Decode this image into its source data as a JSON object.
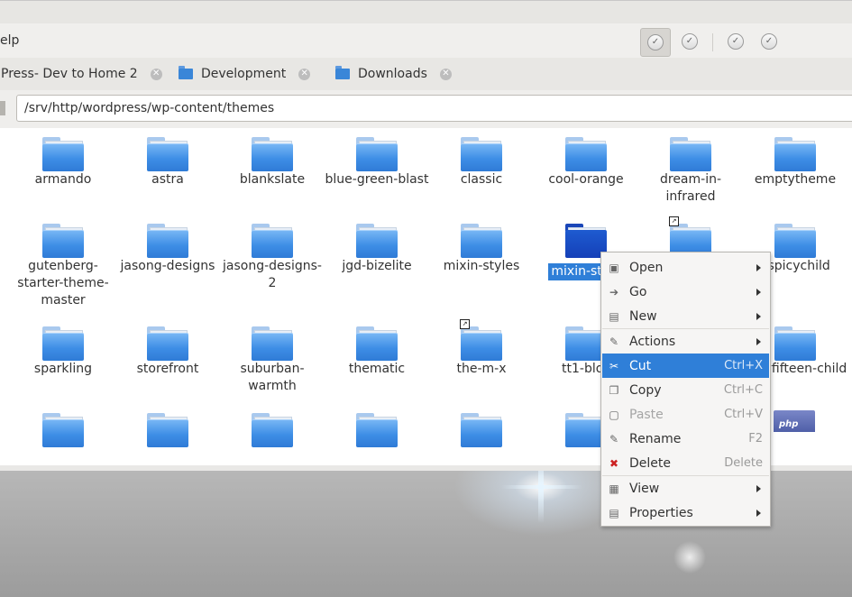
{
  "menu": {
    "help_label": "elp"
  },
  "toolbar": {
    "buttons": [
      {
        "name": "toolbar-check-1",
        "icon": "check-circle-icon",
        "active": true
      },
      {
        "name": "toolbar-check-2",
        "icon": "check-circle-icon",
        "active": false
      },
      {
        "name": "toolbar-check-3",
        "icon": "check-circle-icon",
        "active": false
      },
      {
        "name": "toolbar-check-4",
        "icon": "check-circle-icon",
        "active": false
      }
    ]
  },
  "tabs": [
    {
      "label": "Press- Dev to Home 2",
      "close": "✕"
    },
    {
      "label": "Development",
      "close": "✕"
    },
    {
      "label": "Downloads",
      "close": "✕"
    }
  ],
  "location": {
    "path": "/srv/http/wordpress/wp-content/themes"
  },
  "items": [
    {
      "label": "armando"
    },
    {
      "label": "astra"
    },
    {
      "label": "blankslate"
    },
    {
      "label": "blue-green-blast"
    },
    {
      "label": "classic"
    },
    {
      "label": "cool-orange"
    },
    {
      "label": "dream-in-infrared"
    },
    {
      "label": "emptytheme"
    },
    {
      "label": "gutenberg-starter-theme-master"
    },
    {
      "label": "jasong-designs"
    },
    {
      "label": "jasong-designs-2"
    },
    {
      "label": "jgd-bizelite"
    },
    {
      "label": "mixin-styles"
    },
    {
      "label": "mixin-style",
      "selected": true
    },
    {
      "label": ""
    },
    {
      "label": "yspicychild"
    },
    {
      "label": "sparkling"
    },
    {
      "label": "storefront"
    },
    {
      "label": "suburban-warmth"
    },
    {
      "label": "thematic"
    },
    {
      "label": "the-m-x"
    },
    {
      "label": "tt1-bloc"
    },
    {
      "label": ""
    },
    {
      "label": "entyfifteen-child"
    }
  ],
  "php_badge": "php",
  "context_menu": {
    "items": [
      {
        "label": "Open",
        "icon": "open-folder-icon",
        "submenu": true
      },
      {
        "label": "Go",
        "icon": "go-arrow-icon",
        "submenu": true
      },
      {
        "label": "New",
        "icon": "new-document-icon",
        "submenu": true
      },
      {
        "label": "Actions",
        "icon": "actions-icon",
        "submenu": true
      },
      {
        "label": "Cut",
        "icon": "scissors-icon",
        "shortcut": "Ctrl+X",
        "highlighted": true
      },
      {
        "label": "Copy",
        "icon": "copy-icon",
        "shortcut": "Ctrl+C"
      },
      {
        "label": "Paste",
        "icon": "paste-icon",
        "shortcut": "Ctrl+V",
        "disabled": true
      },
      {
        "label": "Rename",
        "icon": "rename-icon",
        "shortcut": "F2"
      },
      {
        "label": "Delete",
        "icon": "delete-x-icon",
        "shortcut": "Delete"
      },
      {
        "label": "View",
        "icon": "view-icon",
        "submenu": true
      },
      {
        "label": "Properties",
        "icon": "properties-icon",
        "submenu": true
      }
    ]
  }
}
